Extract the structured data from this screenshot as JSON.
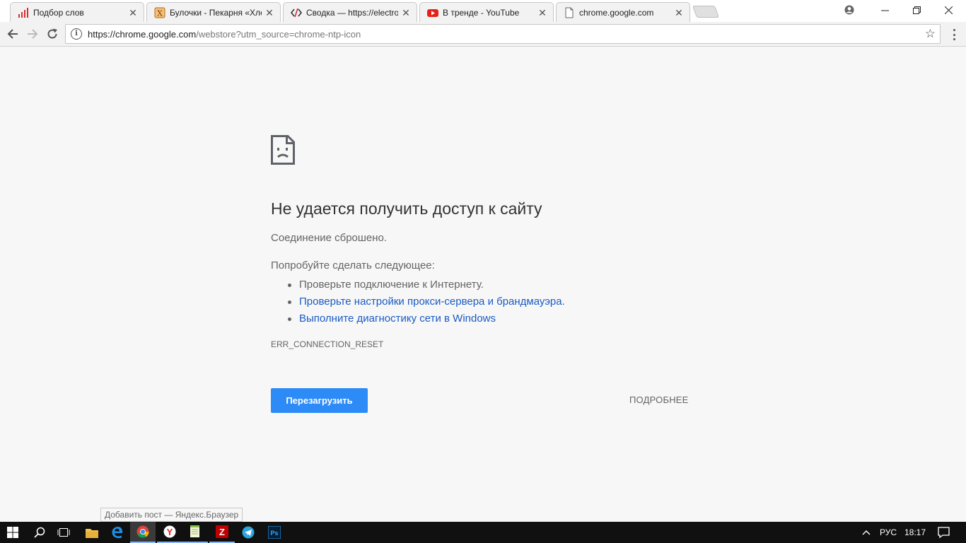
{
  "tabs": [
    {
      "title": "Подбор слов",
      "icon": "bar-chart-icon"
    },
    {
      "title": "Булочки - Пекарня «Хле",
      "icon": "x-badge-icon"
    },
    {
      "title": "Сводка — https://electro",
      "icon": "code-icon"
    },
    {
      "title": "В тренде - YouTube",
      "icon": "youtube-icon"
    },
    {
      "title": "chrome.google.com",
      "icon": "page-icon"
    }
  ],
  "close_glyph": "✕",
  "address": {
    "host": "https://chrome.google.com",
    "rest": "/webstore?utm_source=chrome-ntp-icon"
  },
  "error": {
    "title": "Не удается получить доступ к сайту",
    "summary": "Соединение сброшено.",
    "suggestions_heading": "Попробуйте сделать следующее:",
    "suggestions": [
      "Проверьте подключение к Интернету.",
      "Проверьте настройки прокси-сервера и брандмауэра.",
      "Выполните диагностику сети в Windows"
    ],
    "code": "ERR_CONNECTION_RESET",
    "reload_label": "Перезагрузить",
    "details_label": "ПОДРОБНЕЕ"
  },
  "status_bubble": "Добавить пост — Яндекс.Браузер",
  "taskbar": {
    "language": "РУС",
    "time": "18:17"
  },
  "colors": {
    "link": "#1a5bc4",
    "button": "#2d8bf7",
    "page_bg": "#f7f7f7",
    "taskbar": "#101010"
  }
}
